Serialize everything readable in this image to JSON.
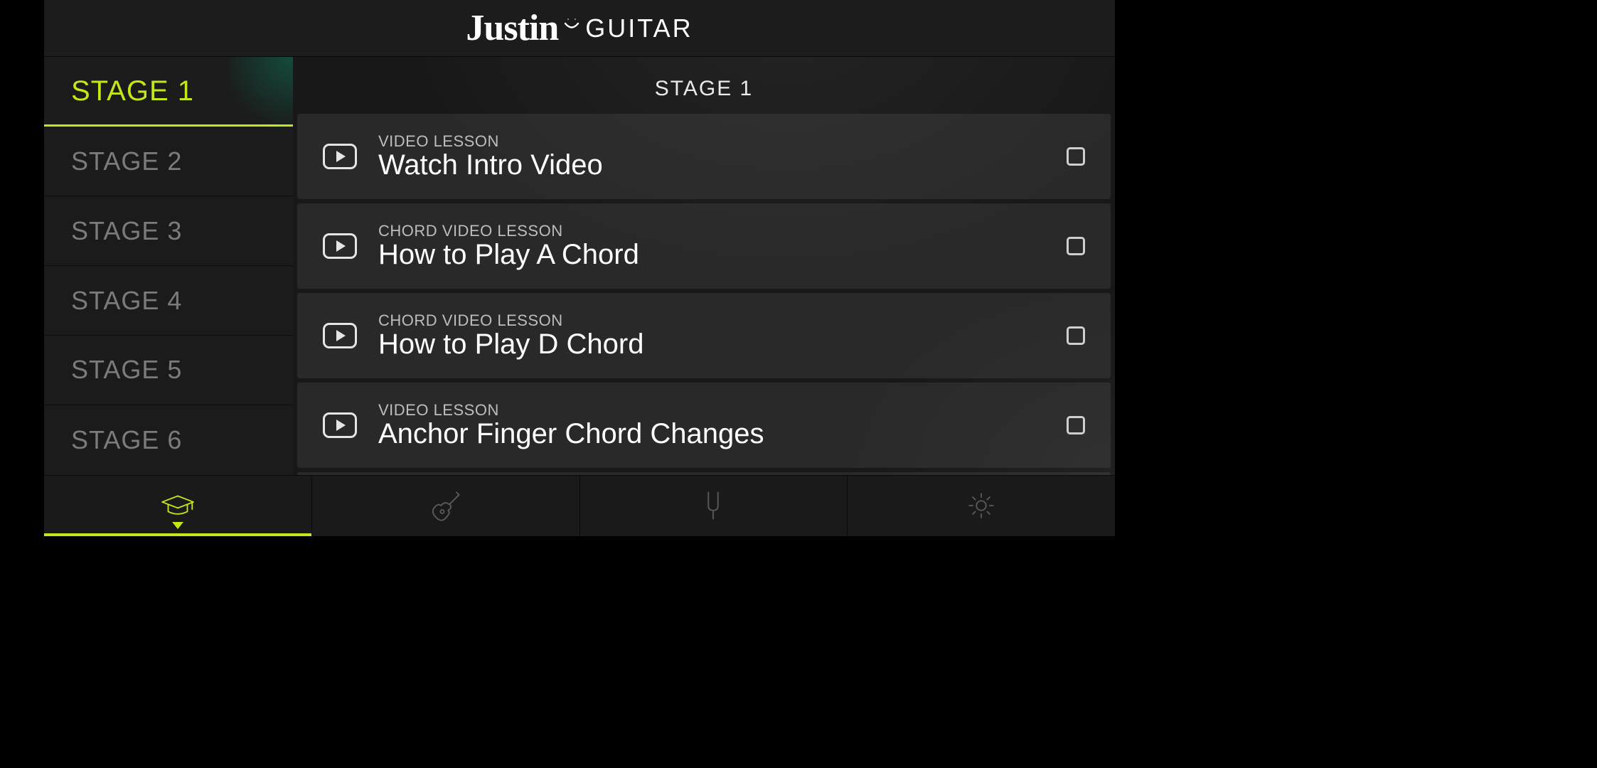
{
  "brand": {
    "script": "Justin",
    "word": "GUITAR"
  },
  "sidebar": {
    "items": [
      {
        "label": "STAGE 1",
        "active": true
      },
      {
        "label": "STAGE 2",
        "active": false
      },
      {
        "label": "STAGE 3",
        "active": false
      },
      {
        "label": "STAGE 4",
        "active": false
      },
      {
        "label": "STAGE 5",
        "active": false
      },
      {
        "label": "STAGE 6",
        "active": false
      }
    ]
  },
  "main": {
    "stage_title": "STAGE 1",
    "lessons": [
      {
        "kicker": "VIDEO LESSON",
        "title": "Watch Intro Video"
      },
      {
        "kicker": "CHORD VIDEO LESSON",
        "title": "How to Play A Chord"
      },
      {
        "kicker": "CHORD VIDEO LESSON",
        "title": "How to Play D Chord"
      },
      {
        "kicker": "VIDEO LESSON",
        "title": "Anchor Finger Chord Changes"
      }
    ]
  },
  "tabs": [
    {
      "name": "lessons",
      "active": true,
      "icon": "graduation-cap-icon"
    },
    {
      "name": "songs",
      "active": false,
      "icon": "guitar-icon"
    },
    {
      "name": "tuner",
      "active": false,
      "icon": "tuning-fork-icon"
    },
    {
      "name": "settings",
      "active": false,
      "icon": "gear-icon"
    }
  ],
  "colors": {
    "accent": "#c2e81a",
    "bg": "#1c1c1c",
    "text_muted": "#7b7b7b"
  }
}
